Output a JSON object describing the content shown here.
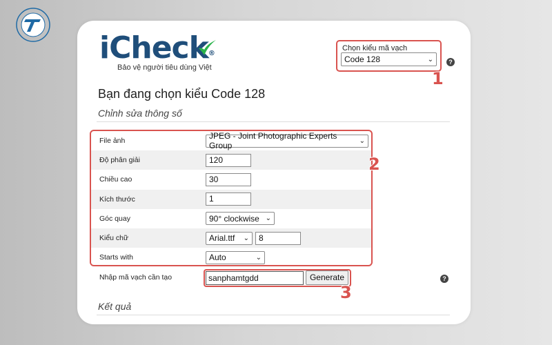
{
  "corner_logo": {
    "icon": "brand-emblem-icon"
  },
  "brand": {
    "name_main": "iChec",
    "name_k": "k",
    "reg": "®",
    "tagline": "Bảo vệ người tiêu dùng Việt"
  },
  "barcode_type": {
    "label": "Chọn kiểu mã vạch",
    "selected": "Code 128"
  },
  "heading": "Bạn đang chọn kiểu Code 128",
  "subheading": "Chỉnh sửa thông số",
  "params": {
    "file": {
      "label": "File ảnh",
      "value": "JPEG - Joint Photographic Experts Group"
    },
    "resolution": {
      "label": "Độ phân giải",
      "value": "120"
    },
    "height": {
      "label": "Chiều cao",
      "value": "30"
    },
    "size": {
      "label": "Kích thước",
      "value": "1"
    },
    "rotation": {
      "label": "Góc quay",
      "value": "90° clockwise"
    },
    "font": {
      "label": "Kiểu chữ",
      "value": "Arial.ttf",
      "size": "8"
    },
    "starts_with": {
      "label": "Starts with",
      "value": "Auto"
    }
  },
  "generate": {
    "label": "Nhập mã vạch cần tạo",
    "value": "sanphamtgdd",
    "button": "Generate"
  },
  "result_heading": "Kết quả",
  "help_glyph": "?",
  "step_numbers": [
    "1",
    "2",
    "3"
  ],
  "colors": {
    "highlight": "#d9534f",
    "brand": "#1f4e7a",
    "accent_green": "#29b34a"
  }
}
